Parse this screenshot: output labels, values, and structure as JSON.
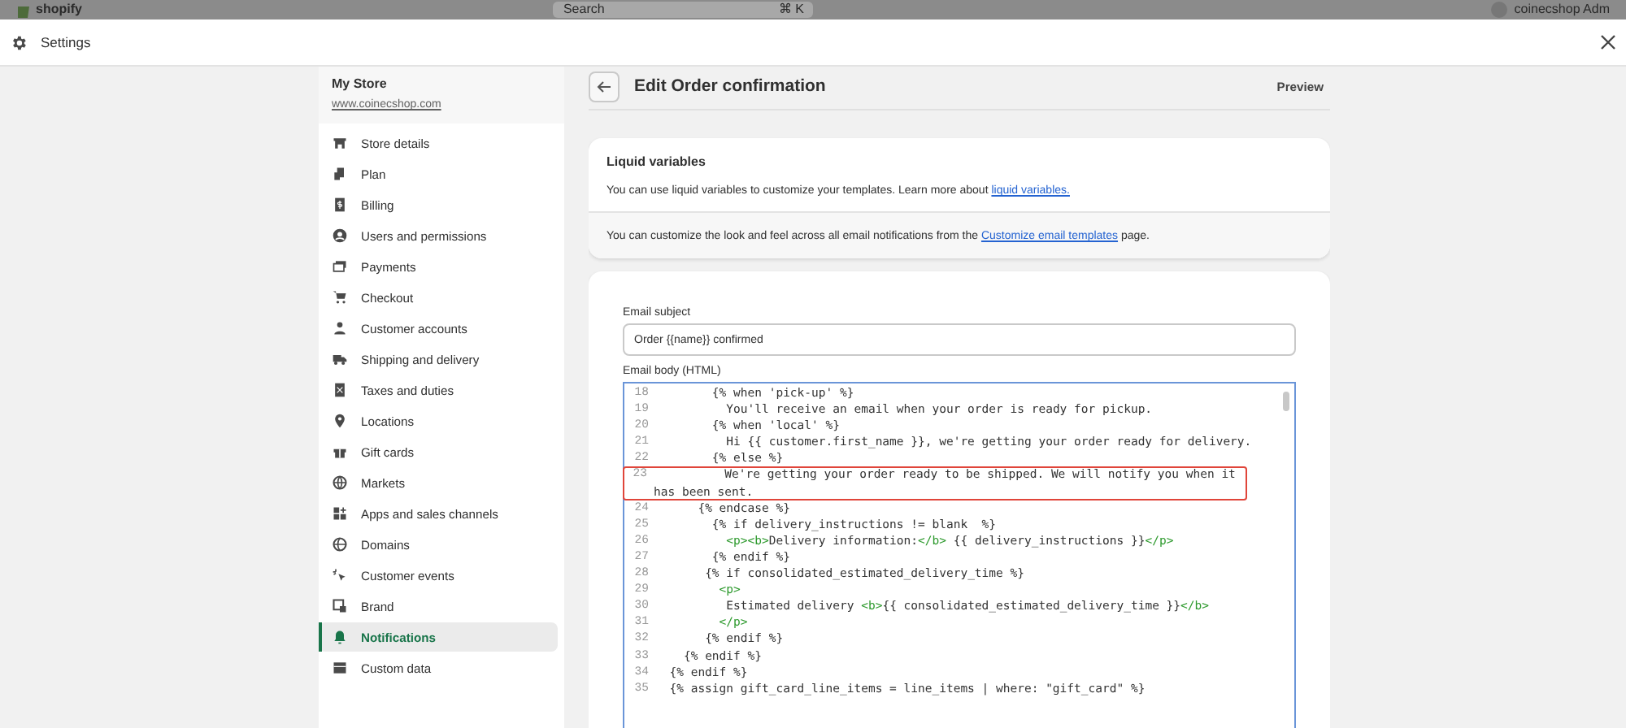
{
  "topbar": {
    "logo": "shopify",
    "search": {
      "placeholder": "Search",
      "shortcut": "⌘ K"
    },
    "account": "coinecshop Adm"
  },
  "window": {
    "title": "Settings"
  },
  "sidebar": {
    "store_name": "My Store",
    "store_url": "www.coinecshop.com",
    "items": [
      {
        "label": "Store details",
        "selected": false
      },
      {
        "label": "Plan",
        "selected": false
      },
      {
        "label": "Billing",
        "selected": false
      },
      {
        "label": "Users and permissions",
        "selected": false
      },
      {
        "label": "Payments",
        "selected": false
      },
      {
        "label": "Checkout",
        "selected": false
      },
      {
        "label": "Customer accounts",
        "selected": false
      },
      {
        "label": "Shipping and delivery",
        "selected": false
      },
      {
        "label": "Taxes and duties",
        "selected": false
      },
      {
        "label": "Locations",
        "selected": false
      },
      {
        "label": "Gift cards",
        "selected": false
      },
      {
        "label": "Markets",
        "selected": false
      },
      {
        "label": "Apps and sales channels",
        "selected": false
      },
      {
        "label": "Domains",
        "selected": false
      },
      {
        "label": "Customer events",
        "selected": false
      },
      {
        "label": "Brand",
        "selected": false
      },
      {
        "label": "Notifications",
        "selected": true
      },
      {
        "label": "Custom data",
        "selected": false
      }
    ]
  },
  "page": {
    "title": "Edit Order confirmation",
    "preview": "Preview"
  },
  "liquid_card": {
    "title": "Liquid variables",
    "text": "You can use liquid variables to customize your templates. Learn more about ",
    "link": "liquid variables.",
    "footer_before": "You can customize the look and feel across all email notifications from the ",
    "footer_link": "Customize email templates",
    "footer_after": " page."
  },
  "email_form": {
    "subject_label": "Email subject",
    "subject_value": "Order {{name}} confirmed",
    "body_label": "Email body (HTML)",
    "code_lines": [
      {
        "number": "18",
        "highlighted": false,
        "segments": [
          {
            "kind": "plain",
            "text": "        {% when 'pick-up' %}"
          }
        ]
      },
      {
        "number": "19",
        "highlighted": false,
        "segments": [
          {
            "kind": "plain",
            "text": "          You'll receive an email when your order is ready for pickup."
          }
        ]
      },
      {
        "number": "20",
        "highlighted": false,
        "segments": [
          {
            "kind": "plain",
            "text": "        {% when 'local' %}"
          }
        ]
      },
      {
        "number": "21",
        "highlighted": false,
        "segments": [
          {
            "kind": "plain",
            "text": "          Hi {{ customer.first_name }}, we're getting your order ready for delivery."
          }
        ]
      },
      {
        "number": "22",
        "highlighted": false,
        "segments": [
          {
            "kind": "plain",
            "text": "        {% else %}"
          }
        ]
      },
      {
        "number": "23",
        "highlighted": true,
        "segments": [
          {
            "kind": "plain",
            "text": "          We're getting your order ready to be shipped. We will notify you when it has been sent."
          }
        ]
      },
      {
        "number": "24",
        "highlighted": false,
        "segments": [
          {
            "kind": "plain",
            "text": "      {% endcase %}"
          }
        ]
      },
      {
        "number": "25",
        "highlighted": false,
        "segments": [
          {
            "kind": "plain",
            "text": "        {% if delivery_instructions != blank  %}"
          }
        ]
      },
      {
        "number": "26",
        "highlighted": false,
        "segments": [
          {
            "kind": "tag",
            "text": "          <p><b>"
          },
          {
            "kind": "plain",
            "text": "Delivery information:"
          },
          {
            "kind": "tag",
            "text": "</b>"
          },
          {
            "kind": "plain",
            "text": " {{ delivery_instructions }}"
          },
          {
            "kind": "tag",
            "text": "</p>"
          }
        ]
      },
      {
        "number": "27",
        "highlighted": false,
        "segments": [
          {
            "kind": "plain",
            "text": "        {% endif %}"
          }
        ]
      },
      {
        "number": "28",
        "highlighted": false,
        "segments": [
          {
            "kind": "plain",
            "text": "       {% if consolidated_estimated_delivery_time %}"
          }
        ]
      },
      {
        "number": "29",
        "highlighted": false,
        "segments": [
          {
            "kind": "tag",
            "text": "         <p>"
          }
        ]
      },
      {
        "number": "30",
        "highlighted": false,
        "segments": [
          {
            "kind": "plain",
            "text": "          Estimated delivery "
          },
          {
            "kind": "tag",
            "text": "<b>"
          },
          {
            "kind": "plain",
            "text": "{{ consolidated_estimated_delivery_time }}"
          },
          {
            "kind": "tag",
            "text": "</b>"
          }
        ]
      },
      {
        "number": "31",
        "highlighted": false,
        "segments": [
          {
            "kind": "tag",
            "text": "         </p>"
          }
        ]
      },
      {
        "number": "32",
        "highlighted": false,
        "segments": [
          {
            "kind": "plain",
            "text": "       {% endif %}"
          }
        ]
      },
      {
        "number": "33",
        "highlighted": false,
        "segments": [
          {
            "kind": "plain",
            "text": "    {% endif %}"
          }
        ]
      },
      {
        "number": "34",
        "highlighted": false,
        "segments": [
          {
            "kind": "plain",
            "text": "  {% endif %}"
          }
        ]
      },
      {
        "number": "35",
        "highlighted": false,
        "segments": [
          {
            "kind": "plain",
            "text": "  {% assign gift_card_line_items = line_items | where: \"gift_card\" %}"
          }
        ]
      }
    ]
  }
}
